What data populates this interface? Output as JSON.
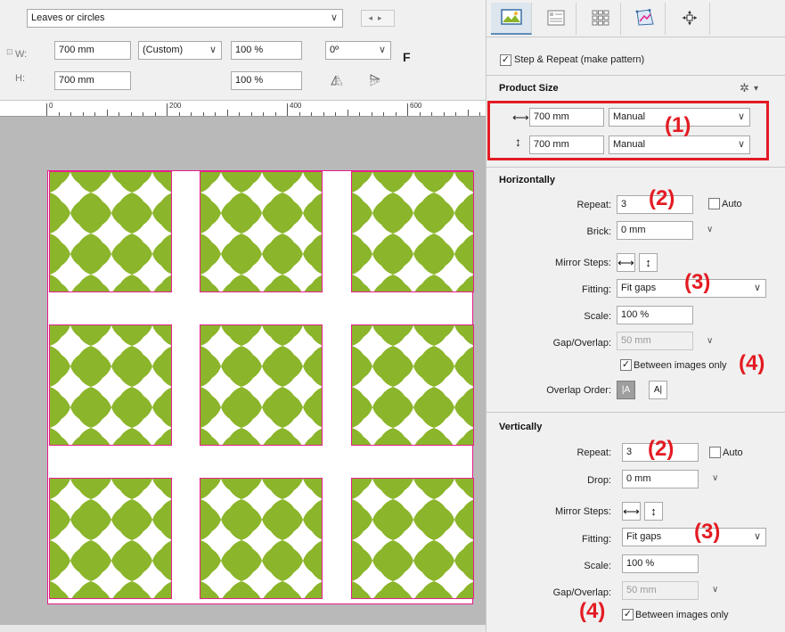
{
  "toolbar": {
    "preset_value": "Leaves or circles",
    "w_label": "W:",
    "w_value": "700 mm",
    "h_label": "H:",
    "h_value": "700 mm",
    "size_mode_value": "(Custom)",
    "w_percent": "100 %",
    "h_percent": "100 %",
    "rotation_value": "0º",
    "anchor_letter": "F"
  },
  "ruler": {
    "marks": [
      "0",
      "200",
      "400",
      "600"
    ]
  },
  "panel": {
    "step_repeat_label": "Step & Repeat (make pattern)",
    "step_repeat_checked": true,
    "product_size": {
      "title": "Product Size",
      "width_value": "700 mm",
      "width_mode": "Manual",
      "height_value": "700 mm",
      "height_mode": "Manual"
    },
    "horizontally": {
      "title": "Horizontally",
      "repeat_label": "Repeat:",
      "repeat_value": "3",
      "auto_label": "Auto",
      "brick_label": "Brick:",
      "brick_value": "0 mm",
      "mirror_label": "Mirror Steps:",
      "fitting_label": "Fitting:",
      "fitting_value": "Fit gaps",
      "scale_label": "Scale:",
      "scale_value": "100 %",
      "gap_label": "Gap/Overlap:",
      "gap_value": "50 mm",
      "between_label": "Between images only",
      "between_checked": true,
      "overlap_label": "Overlap Order:"
    },
    "vertically": {
      "title": "Vertically",
      "repeat_label": "Repeat:",
      "repeat_value": "3",
      "auto_label": "Auto",
      "drop_label": "Drop:",
      "drop_value": "0 mm",
      "mirror_label": "Mirror Steps:",
      "fitting_label": "Fitting:",
      "fitting_value": "Fit gaps",
      "scale_label": "Scale:",
      "scale_value": "100 %",
      "gap_label": "Gap/Overlap:",
      "gap_value": "50 mm",
      "between_label": "Between images only",
      "between_checked": true
    }
  },
  "callouts": {
    "c1": "(1)",
    "c2h": "(2)",
    "c3h": "(3)",
    "c4h": "(4)",
    "c2v": "(2)",
    "c3v": "(3)",
    "c4v": "(4)"
  },
  "colors": {
    "pattern_green": "#8bb52a",
    "tile_border": "#e61e8c",
    "callout_red": "#e31b23"
  }
}
